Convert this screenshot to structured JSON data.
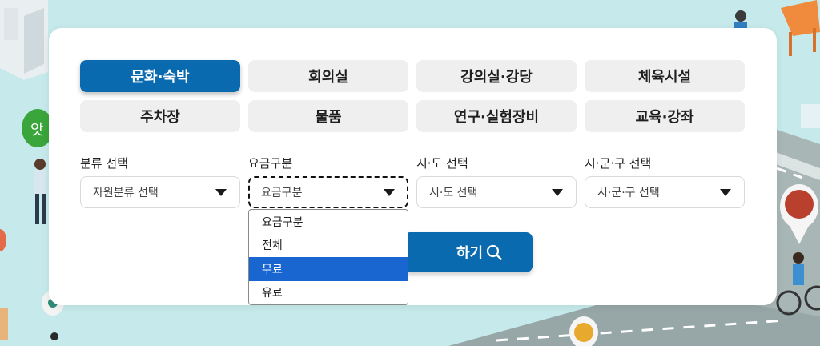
{
  "tabs": [
    {
      "label": "문화·숙박",
      "active": true
    },
    {
      "label": "회의실",
      "active": false
    },
    {
      "label": "강의실·강당",
      "active": false
    },
    {
      "label": "체육시설",
      "active": false
    },
    {
      "label": "주차장",
      "active": false
    },
    {
      "label": "물품",
      "active": false
    },
    {
      "label": "연구·실험장비",
      "active": false
    },
    {
      "label": "교육·강좌",
      "active": false
    }
  ],
  "filters": [
    {
      "label": "분류 선택",
      "value": "자원분류 선택"
    },
    {
      "label": "요금구분",
      "value": "요금구분"
    },
    {
      "label": "시·도 선택",
      "value": "시·도 선택"
    },
    {
      "label": "시·군·구 선택",
      "value": "시·군·구 선택"
    }
  ],
  "dropdown": {
    "options": [
      "요금구분",
      "전체",
      "무료",
      "유료"
    ],
    "highlighted": "무료"
  },
  "search_button": {
    "label": "하기",
    "icon": "search-icon"
  },
  "colors": {
    "accent": "#0a6ab0",
    "tab_inactive": "#efefef",
    "dropdown_highlight": "#1a66d1",
    "background": "#c3e9ea"
  }
}
